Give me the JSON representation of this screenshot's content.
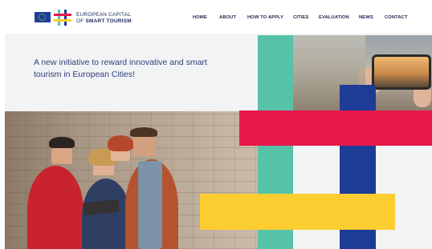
{
  "brand": {
    "line1": "EUROPEAN CAPITAL",
    "line2_prefix": "OF ",
    "line2_bold": "SMART TOURISM"
  },
  "nav": {
    "items": [
      "HOME",
      "ABOUT",
      "HOW TO APPLY",
      "CITIES",
      "EVALUATION",
      "NEWS",
      "CONTACT"
    ]
  },
  "hero": {
    "tagline": "A new initiative to reward innovative and smart tourism in European Cities!"
  },
  "colors": {
    "teal": "#56c2a8",
    "blue": "#1d3c96",
    "red": "#e8174c",
    "yellow": "#fccd31",
    "nav_text": "#1d2550",
    "tagline_text": "#2f3f78"
  },
  "icons": {
    "eu_flag": "eu-flag-icon",
    "logo": "hash-logo-icon"
  }
}
